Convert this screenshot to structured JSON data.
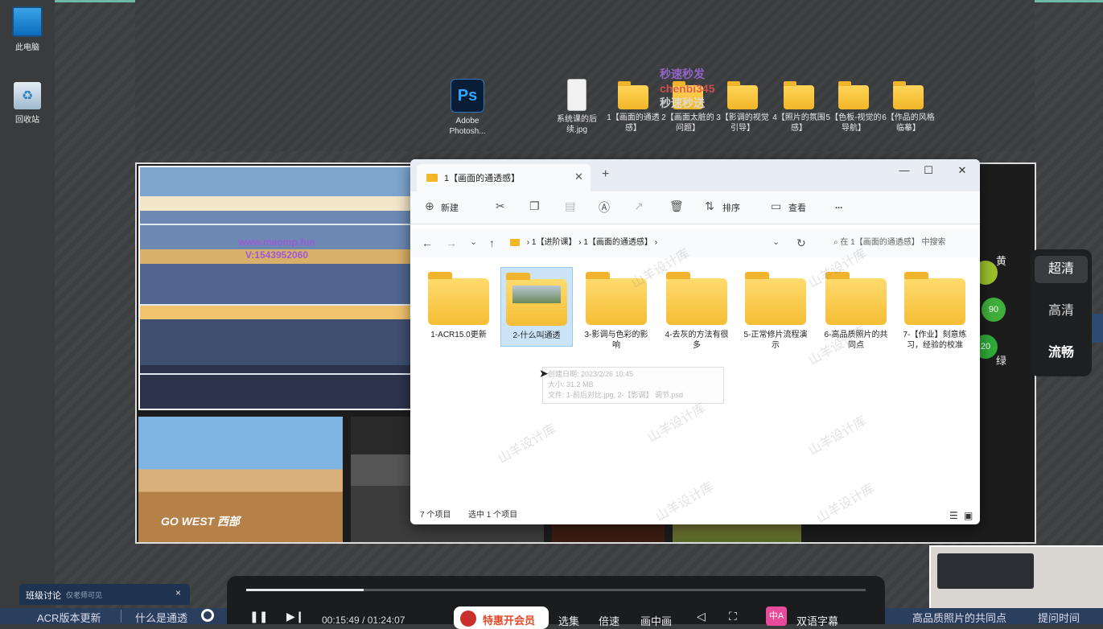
{
  "desktop": {
    "icons_left": [
      {
        "label": "此电脑",
        "icon": "monitor-icon"
      },
      {
        "label": "回收站",
        "icon": "recycle-bin-icon"
      }
    ],
    "icons_top": [
      {
        "label": "Adobe Photosh...",
        "icon": "photoshop-icon"
      },
      {
        "label": "系统课的后续.jpg",
        "icon": "image-file-icon"
      },
      {
        "label": "1【画面的通透感】",
        "icon": "folder-icon"
      },
      {
        "label": "2【画面太脏的问题】",
        "icon": "folder-icon"
      },
      {
        "label": "3【影调的视觉引导】",
        "icon": "folder-icon"
      },
      {
        "label": "4【照片的氛围感】",
        "icon": "folder-icon"
      },
      {
        "label": "5【色板-视觉的导航】",
        "icon": "folder-icon"
      },
      {
        "label": "6【作品的风格临摹】",
        "icon": "folder-icon"
      }
    ],
    "overlay_watermark": [
      "秒速秒发",
      "chenbi345",
      "秒速秒送"
    ]
  },
  "photo_watermark": {
    "line1": "www.maomp.fun",
    "line2": "V:1543952060"
  },
  "go_west_text": "GO WEST 西部",
  "side_indicators": {
    "top_label": "黄",
    "bottom_label": "绿",
    "values": [
      "90",
      "20"
    ]
  },
  "quality_menu": {
    "items": [
      "超清",
      "高清",
      "流畅"
    ],
    "active": "超清"
  },
  "explorer": {
    "tab_title": "1【画面的通透感】",
    "toolbar": {
      "new": "新建",
      "sort": "排序",
      "view": "查看",
      "more": "..."
    },
    "breadcrumb": [
      "1【进阶课】",
      "1【画面的通透感】"
    ],
    "search_placeholder": "在 1【画面的通透感】 中搜索",
    "items": [
      {
        "label": "1-ACR15.0更新",
        "selected": false
      },
      {
        "label": "2-什么叫通透",
        "selected": true
      },
      {
        "label": "3-影调与色彩的影响",
        "selected": false
      },
      {
        "label": "4-去灰的方法有很多",
        "selected": false
      },
      {
        "label": "5-正常修片流程演示",
        "selected": false
      },
      {
        "label": "6-高品质照片的共同点",
        "selected": false
      },
      {
        "label": "7-【作业】刻意练习，经验的校准",
        "selected": false
      }
    ],
    "tooltip": {
      "line1": "创建日期: 2023/2/26 10:45",
      "line2": "大小: 31.2 MB",
      "line3": "文件: 1-前后对比.jpg, 2-【影调】 调节.psd"
    },
    "status": {
      "count": "7 个项目",
      "selected": "选中 1 个项目"
    }
  },
  "watermark_text": "山羊设计库",
  "player": {
    "progress": 0.19,
    "current_time": "00:15:49",
    "total_time": "01:24:07",
    "time_separator": "/",
    "vip_label": "特惠开会员",
    "menu": [
      "选集",
      "倍速",
      "画中画"
    ],
    "subtitle_label": "双语字幕",
    "subtitle_icon_text": "中A"
  },
  "chat": {
    "title": "班级讨论",
    "subtitle": "仅老师可见",
    "close": "×"
  },
  "bottom_nav": {
    "items": [
      "ACR版本更新",
      "什么是通透"
    ],
    "right_items": [
      "高品质照片的共同点",
      "提问时间"
    ]
  }
}
